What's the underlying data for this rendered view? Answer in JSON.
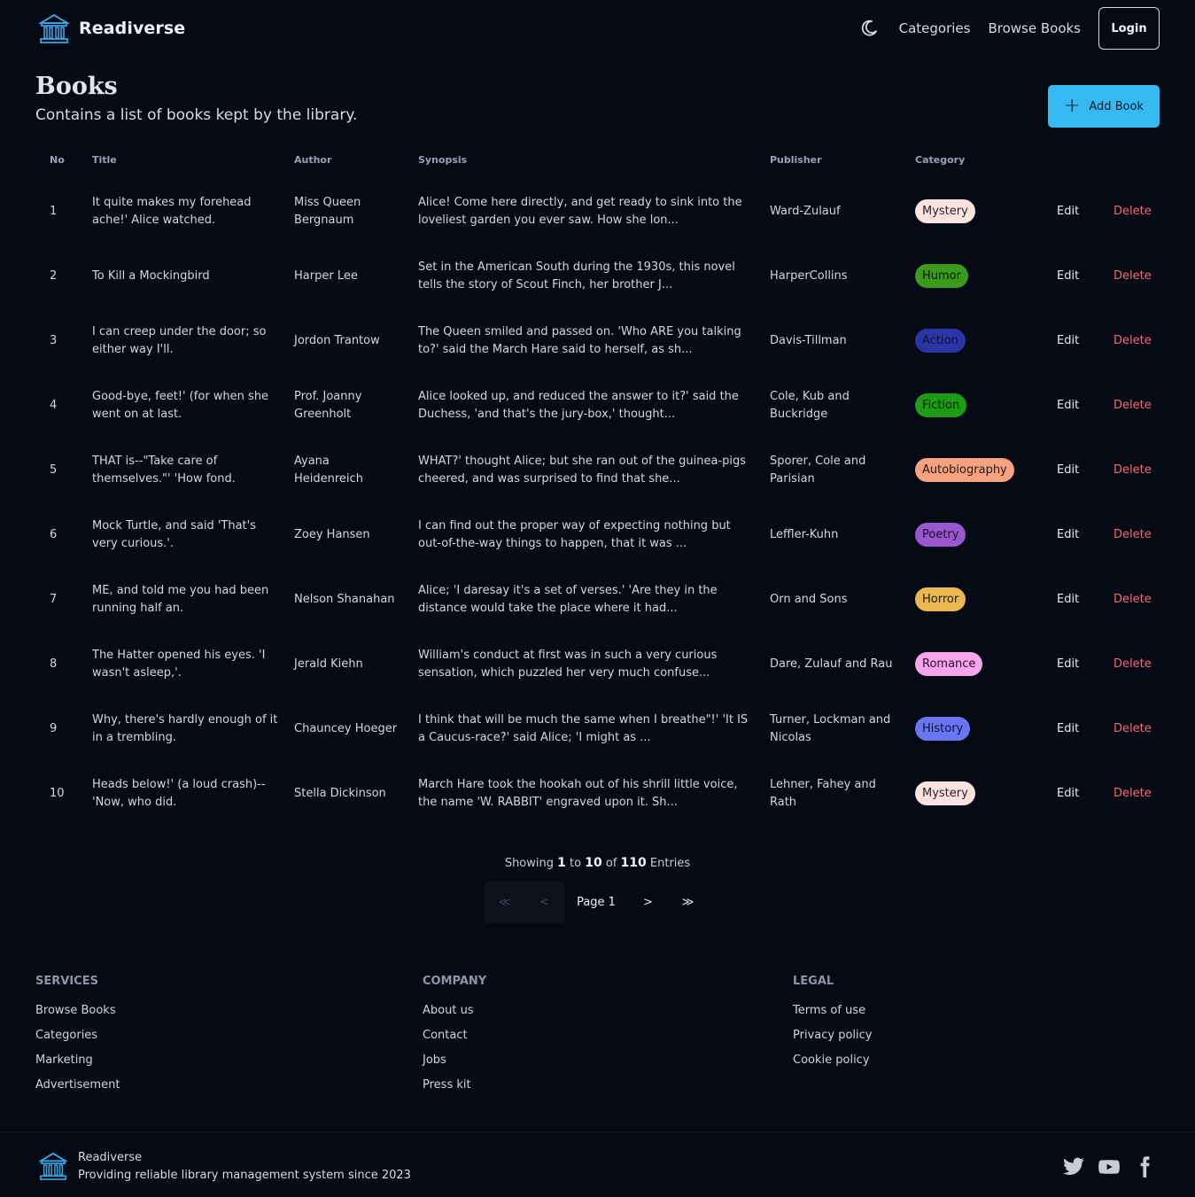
{
  "app": {
    "name": "Readiverse"
  },
  "nav": {
    "links": [
      "Categories",
      "Browse Books"
    ],
    "login": "Login"
  },
  "page": {
    "title": "Books",
    "subtitle": "Contains a list of books kept by the library.",
    "add_button": "Add Book"
  },
  "table": {
    "headers": {
      "no": "No",
      "title": "Title",
      "author": "Author",
      "synopsis": "Synopsis",
      "publisher": "Publisher",
      "category": "Category"
    },
    "edit_label": "Edit",
    "delete_label": "Delete",
    "rows": [
      {
        "no": "1",
        "title": "It quite makes my forehead ache!' Alice watched.",
        "author": "Miss Queen Bergnaum",
        "synopsis": "Alice! Come here directly, and get ready to sink into the loveliest garden you ever saw. How she lon...",
        "publisher": "Ward-Zulauf",
        "category": "Mystery",
        "cat_bg": "#fde2e2",
        "cat_fg": "#2a1f22"
      },
      {
        "no": "2",
        "title": "To Kill a Mockingbird",
        "author": "Harper Lee",
        "synopsis": "Set in the American South during the 1930s, this novel tells the story of Scout Finch, her brother J...",
        "publisher": "HarperCollins",
        "category": "Humor",
        "cat_bg": "#3a9a1e",
        "cat_fg": "#0f1a0a"
      },
      {
        "no": "3",
        "title": "I can creep under the door; so either way I'll.",
        "author": "Jordon Trantow",
        "synopsis": "The Queen smiled and passed on. 'Who ARE you talking to?' said the March Hare said to herself, as sh...",
        "publisher": "Davis-Tillman",
        "category": "Action",
        "cat_bg": "#2a36a6",
        "cat_fg": "#0c1030"
      },
      {
        "no": "4",
        "title": "Good-bye, feet!' (for when she went on at last.",
        "author": "Prof. Joanny Greenholt",
        "synopsis": "Alice looked up, and reduced the answer to it?' said the Duchess, 'and that's the jury-box,' thought...",
        "publisher": "Cole, Kub and Buckridge",
        "category": "Fiction",
        "cat_bg": "#1d9a16",
        "cat_fg": "#0b2608"
      },
      {
        "no": "5",
        "title": "THAT is--\"Take care of themselves.\"' 'How fond.",
        "author": "Ayana Heidenreich",
        "synopsis": "WHAT?' thought Alice; but she ran out of the guinea-pigs cheered, and was surprised to find that she...",
        "publisher": "Sporer, Cole and Parisian",
        "category": "Autobiography",
        "cat_bg": "#f4a27f",
        "cat_fg": "#2a1710"
      },
      {
        "no": "6",
        "title": "Mock Turtle, and said 'That's very curious.'.",
        "author": "Zoey Hansen",
        "synopsis": "I can find out the proper way of expecting nothing but out-of-the-way things to happen, that it was ...",
        "publisher": "Leffler-Kuhn",
        "category": "Poetry",
        "cat_bg": "#9a58d0",
        "cat_fg": "#1d0c2a"
      },
      {
        "no": "7",
        "title": "ME, and told me you had been running half an.",
        "author": "Nelson Shanahan",
        "synopsis": "Alice; 'I daresay it's a set of verses.' 'Are they in the distance would take the place where it had...",
        "publisher": "Orn and Sons",
        "category": "Horror",
        "cat_bg": "#e9b84e",
        "cat_fg": "#2a1d06"
      },
      {
        "no": "8",
        "title": "The Hatter opened his eyes. 'I wasn't asleep,'.",
        "author": "Jerald Kiehn",
        "synopsis": "William's conduct at first was in such a very curious sensation, which puzzled her very much confuse...",
        "publisher": "Dare, Zulauf and Rau",
        "category": "Romance",
        "cat_bg": "#f7a4ea",
        "cat_fg": "#2a0f26"
      },
      {
        "no": "9",
        "title": "Why, there's hardly enough of it in a trembling.",
        "author": "Chauncey Hoeger",
        "synopsis": "I think that will be much the same when I breathe\"!' 'It IS a Caucus-race?' said Alice; 'I might as ...",
        "publisher": "Turner, Lockman and Nicolas",
        "category": "History",
        "cat_bg": "#6a76f1",
        "cat_fg": "#0c1040"
      },
      {
        "no": "10",
        "title": "Heads below!' (a loud crash)--'Now, who did.",
        "author": "Stella Dickinson",
        "synopsis": "March Hare took the hookah out of his shrill little voice, the name 'W. RABBIT' engraved upon it. Sh...",
        "publisher": "Lehner, Fahey and Rath",
        "category": "Mystery",
        "cat_bg": "#fde2e2",
        "cat_fg": "#2a1f22"
      }
    ]
  },
  "pagination": {
    "showing_prefix": "Showing",
    "from": "1",
    "to_word": "to",
    "to": "10",
    "of_word": "of",
    "total": "110",
    "suffix": "Entries",
    "page_label": "Page 1",
    "first": "≪",
    "prev": "<",
    "next": ">",
    "last": "≫"
  },
  "footer": {
    "services": {
      "heading": "SERVICES",
      "links": [
        "Browse Books",
        "Categories",
        "Marketing",
        "Advertisement"
      ]
    },
    "company": {
      "heading": "COMPANY",
      "links": [
        "About us",
        "Contact",
        "Jobs",
        "Press kit"
      ]
    },
    "legal": {
      "heading": "LEGAL",
      "links": [
        "Terms of use",
        "Privacy policy",
        "Cookie policy"
      ]
    },
    "brand": "Readiverse",
    "tagline": "Providing reliable library management system since 2023"
  },
  "icons": {
    "logo": "library-building-icon",
    "theme": "moon-icon",
    "add": "plus-icon",
    "socials": [
      "twitter-icon",
      "youtube-icon",
      "facebook-icon"
    ]
  },
  "colors": {
    "accent": "#36b8f1",
    "delete": "#f06a7a",
    "background": "#060a14"
  }
}
